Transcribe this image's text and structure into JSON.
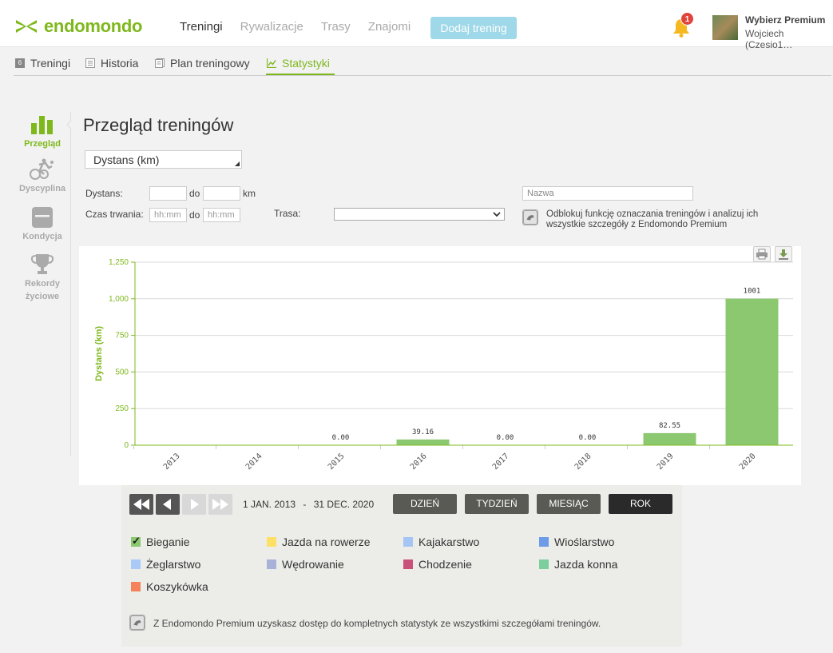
{
  "brand": {
    "name": "endomondo"
  },
  "topnav": {
    "items": [
      "Treningi",
      "Rywalizacje",
      "Trasy",
      "Znajomi"
    ],
    "add_button": "Dodaj trening",
    "notifications_count": "1",
    "user_title": "Wybierz Premium",
    "user_name": "Wojciech (Czesio1…"
  },
  "subnav": {
    "items": [
      {
        "label": "Treningi",
        "icon": "count-badge-icon",
        "badge": "6"
      },
      {
        "label": "Historia",
        "icon": "list-icon"
      },
      {
        "label": "Plan treningowy",
        "icon": "document-icon"
      },
      {
        "label": "Statystyki",
        "icon": "line-chart-icon"
      }
    ]
  },
  "sidenav": {
    "items": [
      {
        "label": "Przegląd",
        "icon": "bar-chart-icon"
      },
      {
        "label": "Dyscyplina",
        "icon": "triathlon-icon"
      },
      {
        "label": "Kondycja",
        "icon": "scale-icon"
      },
      {
        "label": "Rekordy życiowe",
        "icon": "trophy-icon"
      }
    ]
  },
  "main": {
    "title": "Przegląd treningów",
    "metric_select": "Dystans (km)",
    "filters": {
      "distance_label": "Dystans:",
      "to_label": "do",
      "km_unit": "km",
      "duration_label": "Czas trwania:",
      "time_placeholder": "hh:mm",
      "route_label": "Trasa:",
      "name_placeholder": "Nazwa"
    },
    "premium_note": "Odblokuj funkcję oznaczania treningów i analizuj ich wszystkie szczegóły z Endomondo Premium"
  },
  "chart_data": {
    "type": "bar",
    "categories": [
      "2013",
      "2014",
      "2015",
      "2016",
      "2017",
      "2018",
      "2019",
      "2020"
    ],
    "values": [
      0,
      0,
      0,
      39.16,
      0,
      0,
      82.55,
      1001
    ],
    "data_labels": [
      "",
      "",
      "0.00",
      "39.16",
      "0.00",
      "0.00",
      "82.55",
      "1001"
    ],
    "ylabel": "Dystans (km)",
    "yticks": [
      0,
      250,
      500,
      750,
      1000,
      1250
    ],
    "ytick_labels": [
      "0",
      "250",
      "500",
      "750",
      "1,000",
      "1,250"
    ],
    "ylim": [
      0,
      1250
    ],
    "grid": true,
    "bar_color": "#8cc870"
  },
  "controls": {
    "date_from": "1 JAN. 2013",
    "date_sep": "-",
    "date_to": "31 DEC. 2020",
    "periods": [
      "DZIEŃ",
      "TYDZIEŃ",
      "MIESIĄC",
      "ROK"
    ],
    "active_period": "ROK"
  },
  "sports": [
    {
      "label": "Bieganie",
      "color": "#8cc870",
      "checked": true
    },
    {
      "label": "Jazda na rowerze",
      "color": "#ffe066"
    },
    {
      "label": "Kajakarstwo",
      "color": "#a5c5f5"
    },
    {
      "label": "Wioślarstwo",
      "color": "#6e9be8"
    },
    {
      "label": "Żeglarstwo",
      "color": "#a9c9f7"
    },
    {
      "label": "Wędrowanie",
      "color": "#a8b2d8"
    },
    {
      "label": "Chodzenie",
      "color": "#c9507a"
    },
    {
      "label": "Jazda konna",
      "color": "#7ccf9d"
    },
    {
      "label": "Koszykówka",
      "color": "#f5825a"
    }
  ],
  "bottom_note": "Z Endomondo Premium uzyskasz dostęp do kompletnych statystyk ze wszystkimi szczegółami treningów."
}
